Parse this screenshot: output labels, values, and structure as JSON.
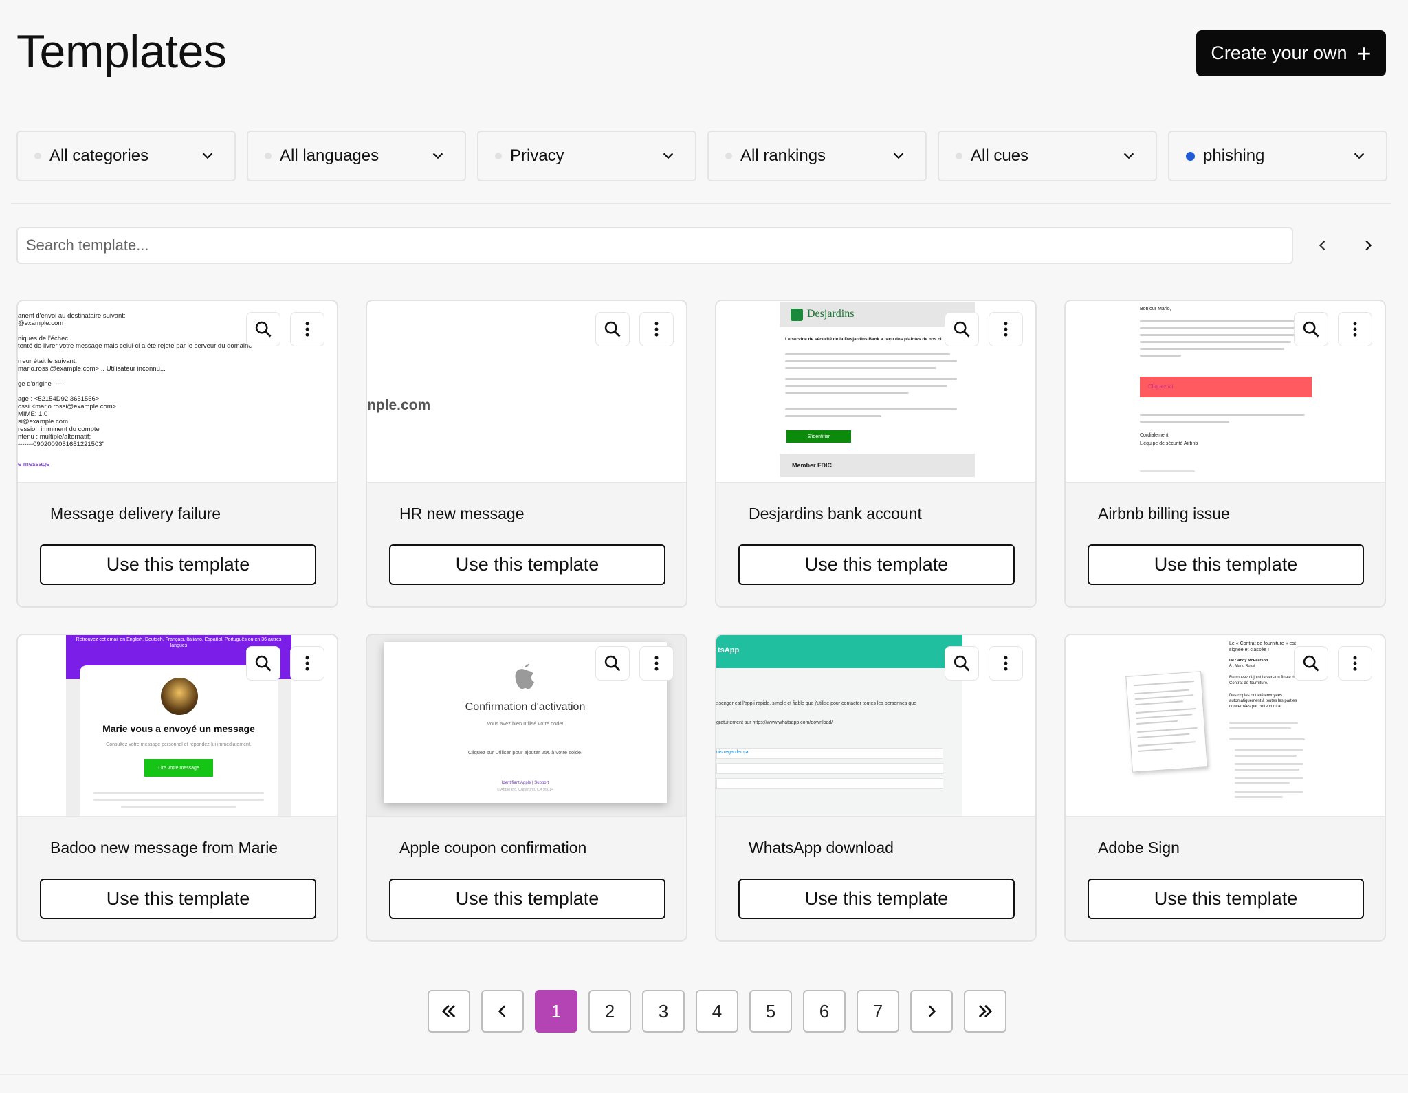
{
  "header": {
    "title": "Templates",
    "create_label": "Create your own"
  },
  "filters": [
    {
      "label": "All categories",
      "active": false
    },
    {
      "label": "All languages",
      "active": false
    },
    {
      "label": "Privacy",
      "active": false
    },
    {
      "label": "All rankings",
      "active": false
    },
    {
      "label": "All cues",
      "active": false
    },
    {
      "label": "phishing",
      "active": true
    }
  ],
  "search": {
    "placeholder": "Search template..."
  },
  "templates": [
    {
      "title": "Message delivery failure",
      "button": "Use this template"
    },
    {
      "title": "HR new message",
      "button": "Use this template"
    },
    {
      "title": "Desjardins bank account",
      "button": "Use this template"
    },
    {
      "title": "Airbnb billing issue",
      "button": "Use this template"
    },
    {
      "title": "Badoo new message from Marie",
      "button": "Use this template"
    },
    {
      "title": "Apple coupon confirmation",
      "button": "Use this template"
    },
    {
      "title": "WhatsApp download",
      "button": "Use this template"
    },
    {
      "title": "Adobe Sign",
      "button": "Use this template"
    }
  ],
  "thumbs": {
    "delivery": {
      "lines": [
        "anent d'envoi au destinataire suivant:",
        "@example.com",
        "",
        "niques de l'échec:",
        "tenté de livrer votre message mais celui-ci a été rejeté par le serveur du domaine",
        "",
        "rreur était le suivant:",
        "mario.rossi@example.com>... Utilisateur inconnu...",
        "",
        "ge d'origine -----",
        "",
        "age : <52154D92.3651556>",
        "ossi <mario.rossi@example.com>",
        "MIME: 1.0",
        "si@example.com",
        "ression imminent du compte",
        "ntenu : multiple/alternatif;",
        "-------0902009051651221503\""
      ],
      "link": "e message"
    },
    "hr": {
      "domain": "nple.com"
    },
    "desjardins": {
      "brand": "Desjardins",
      "intro": "Le service de sécurité de la Desjardins Bank a reçu des plaintes de nos cl",
      "cta": "S'identifier",
      "footer": "Member FDIC"
    },
    "airbnb": {
      "greeting": "Bonjour Mario,",
      "link_text": "Cliquez ici",
      "sign1": "Cordialement,",
      "sign2": "L'équipe de sécurité Airbnb"
    },
    "badoo": {
      "banner": "Retrouvez cet email en English, Deutsch, Français, Italiano, Español, Português ou en 36 autres langues",
      "headline": "Marie vous a envoyé un message",
      "sub": "Consultez votre message personnel et répondez-lui immédiatement.",
      "cta": "Lire votre message"
    },
    "apple": {
      "heading": "Confirmation d'activation",
      "line1": "Vous avez bien utilisé votre code!",
      "line2": "Cliquez sur Utiliser pour ajouter 25€ à votre solde.",
      "footer": "Identifiant Apple | Support",
      "copyright": "© Apple Inc. Cupertino, CA 95014"
    },
    "whatsapp": {
      "brand": "tsApp",
      "line1": "ssenger est l'appli rapide, simple et fiable que j'utilise pour contacter toutes les personnes que",
      "line2": "gratuitement sur https://www.whatsapp.com/download/",
      "line3": "uis regarder ça."
    },
    "adobe": {
      "top": "Le « Contrat de fourniture » est signée et classée !",
      "from": "De : Andy McPearson",
      "to": "À : Mario Rossi",
      "b1": "Retrouvez ci-joint la version finale de ce Contrat de fourniture.",
      "b2": "Des copies ont été envoyées automatiquement à toutes les parties concernées par cette contrat."
    }
  },
  "pagination": {
    "first": "«",
    "prev": "‹",
    "pages": [
      "1",
      "2",
      "3",
      "4",
      "5",
      "6",
      "7"
    ],
    "current": "1",
    "next": "›",
    "last": "»"
  },
  "colors": {
    "accent": "#b444b4",
    "active_dot": "#1f5bd9",
    "primary_button": "#0a0a0a"
  }
}
